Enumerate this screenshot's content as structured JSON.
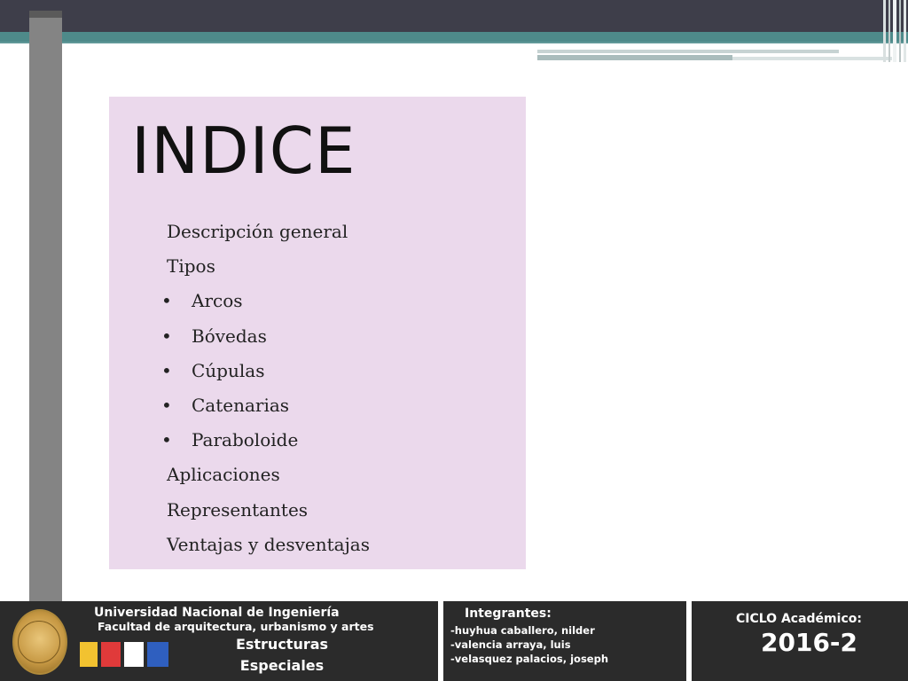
{
  "slide": {
    "title": "INDICE",
    "items": [
      {
        "label": "Descripción general",
        "bullet": false
      },
      {
        "label": "Tipos",
        "bullet": false
      },
      {
        "label": "Arcos",
        "bullet": true
      },
      {
        "label": "Bóvedas",
        "bullet": true
      },
      {
        "label": "Cúpulas",
        "bullet": true
      },
      {
        "label": "Catenarias",
        "bullet": true
      },
      {
        "label": "Paraboloide",
        "bullet": true
      },
      {
        "label": "Aplicaciones",
        "bullet": false
      },
      {
        "label": "Representantes",
        "bullet": false
      },
      {
        "label": "Ventajas y desventajas",
        "bullet": false
      }
    ],
    "panel_color": "#ebd9ec"
  },
  "footer": {
    "university": "Universidad Nacional de Ingeniería",
    "faculty": "Facultad de arquitectura, urbanismo y artes",
    "subject_line1": "Estructuras",
    "subject_line2": "Especiales",
    "logo_icon": "faua-logo",
    "seal_icon": "university-seal-icon",
    "members_title": "Integrantes:",
    "members": [
      "-huyhua caballero, nilder",
      "-valencia arraya, luis",
      "-velasquez palacios, joseph"
    ],
    "cycle_label": "CICLO Académico:",
    "cycle_value": "2016-2"
  },
  "colors": {
    "header_dark": "#3e3e4a",
    "header_teal": "#4e8a8a",
    "footer_bg": "#2b2b2b",
    "side_bar": "#848484"
  }
}
